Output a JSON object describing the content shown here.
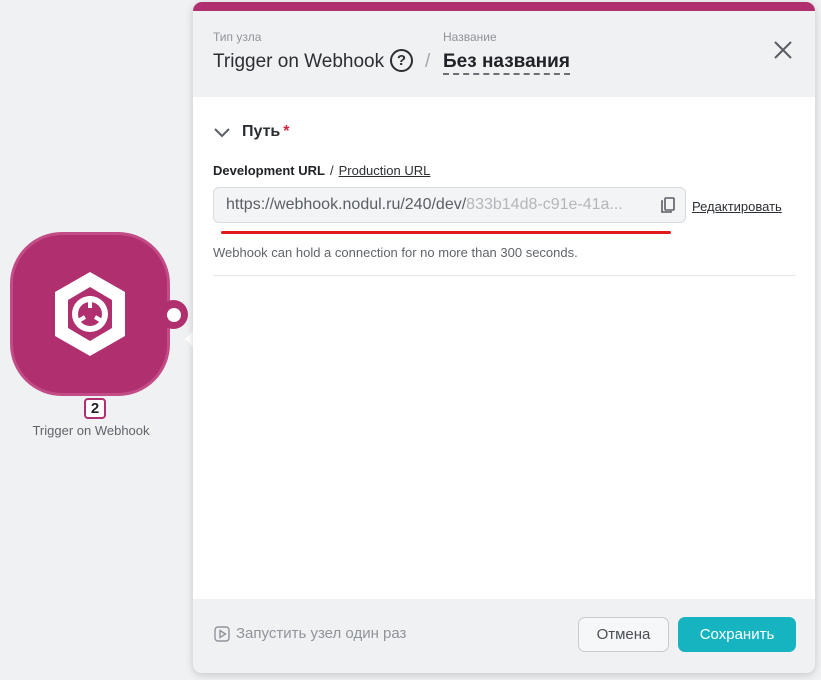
{
  "node": {
    "number": "2",
    "caption": "Trigger on Webhook",
    "icon": "webhook-hexagon-icon",
    "color": "#b0306f"
  },
  "panel": {
    "accent_color": "#b0306f",
    "header": {
      "type_label": "Тип узла",
      "type_value": "Trigger on Webhook",
      "help_symbol": "?",
      "separator": "/",
      "name_label": "Название",
      "name_value": "Без названия"
    },
    "section": {
      "title": "Путь",
      "required_mark": "*",
      "dev_tab": "Development URL",
      "tab_separator": "/",
      "prod_tab": "Production URL",
      "url_base": "https://webhook.nodul.ru/240/dev/",
      "url_id": "833b14d8-c91e-41a...",
      "edit_link": "Редактировать",
      "hint": "Webhook can hold a connection for no more than 300 seconds."
    },
    "footer": {
      "run_once": "Запустить узел один раз",
      "cancel": "Отмена",
      "save": "Сохранить",
      "save_color": "#16b4c0"
    }
  }
}
